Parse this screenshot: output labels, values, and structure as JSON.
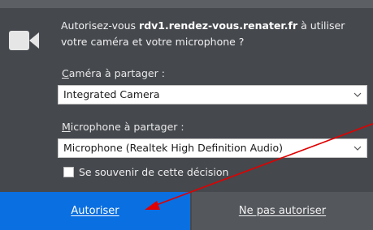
{
  "prompt": {
    "message_prefix": "Autorisez-vous ",
    "domain": "rdv1.rendez-vous.renater.fr",
    "message_suffix_line1": " à utiliser",
    "message_line2": "votre caméra et votre microphone ?",
    "icon": "camera-icon"
  },
  "camera": {
    "label_mnemonic": "C",
    "label_rest": "améra à partager :",
    "selected": "Integrated Camera"
  },
  "microphone": {
    "label_mnemonic": "M",
    "label_rest": "icrophone à partager :",
    "selected": "Microphone (Realtek High Definition Audio)"
  },
  "remember": {
    "label": "Se souvenir de cette décision",
    "checked": false
  },
  "buttons": {
    "allow": "Autoriser",
    "deny": "Ne pas autoriser"
  },
  "colors": {
    "panel": "#45484d",
    "allow_button": "#0a6fe0",
    "deny_button": "#54575c",
    "annotation_arrow": "#e00000"
  }
}
